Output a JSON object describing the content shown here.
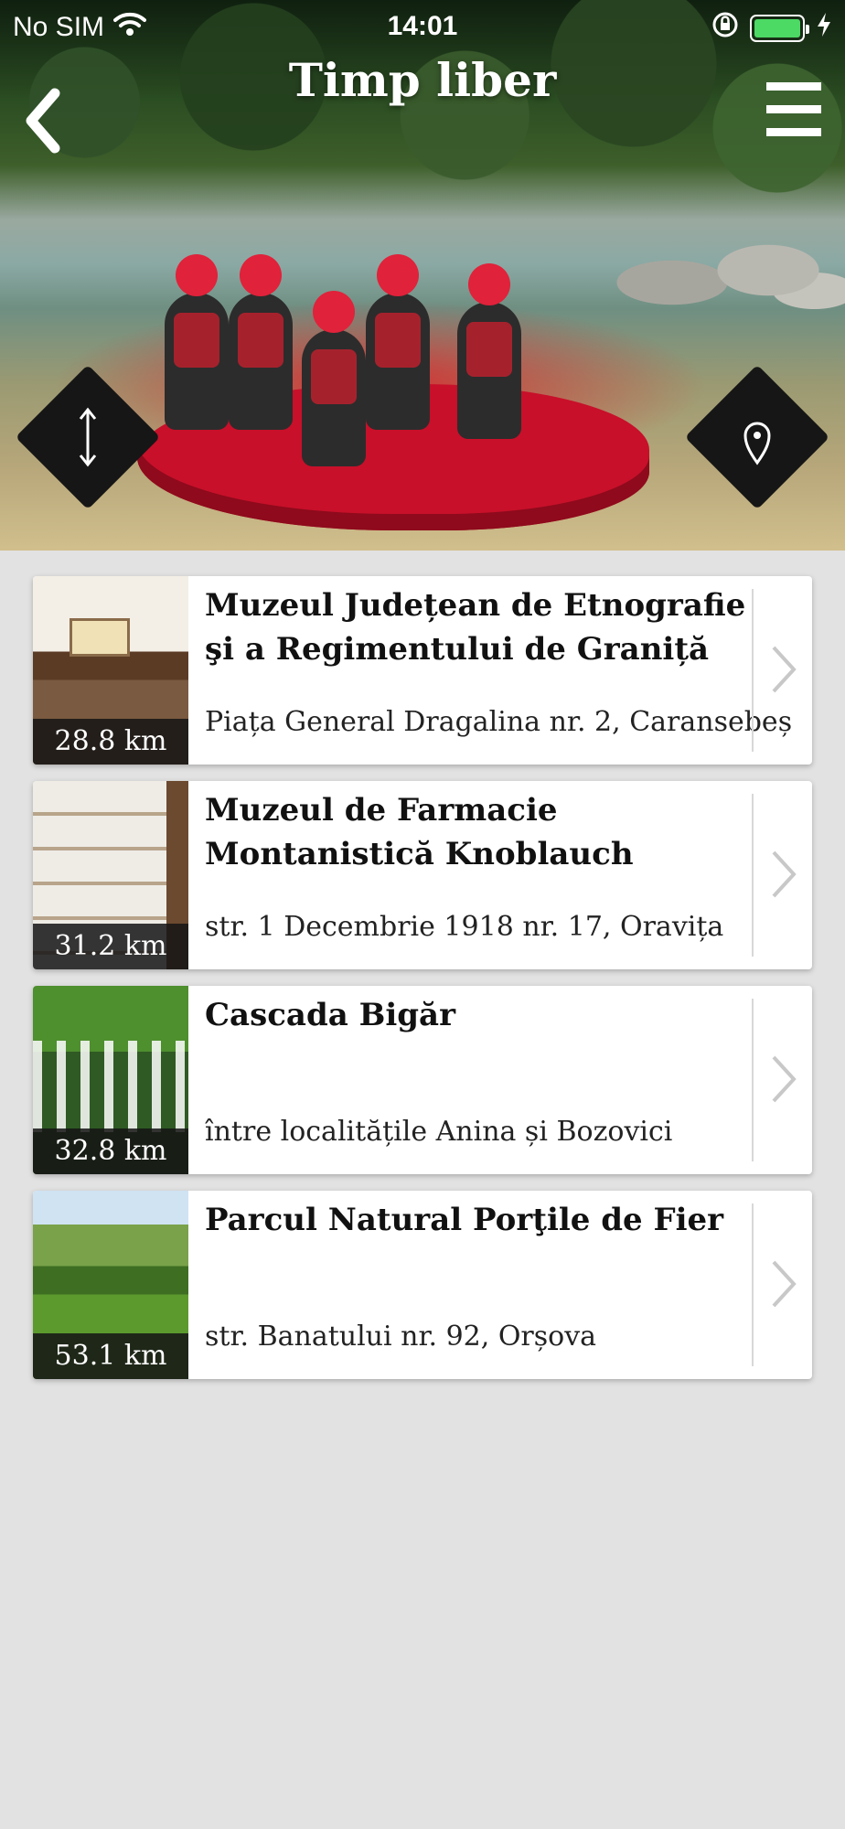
{
  "status_bar": {
    "carrier": "No SIM",
    "time": "14:01"
  },
  "header": {
    "title": "Timp liber"
  },
  "colors": {
    "background": "#e2e2e2",
    "button_dark": "#161616",
    "battery": "#4cd964"
  },
  "items": [
    {
      "title": "Muzeul Județean de Etnografie şi a Regimentului de Graniță",
      "address": "Piața General Dragalina nr. 2, Caransebeș",
      "distance": "28.8 km"
    },
    {
      "title": "Muzeul de Farmacie Montanistică Knoblauch",
      "address": "str. 1 Decembrie 1918 nr. 17, Oravița",
      "distance": "31.2 km"
    },
    {
      "title": "Cascada Bigăr",
      "address": "între localitățile Anina și Bozovici",
      "distance": "32.8 km"
    },
    {
      "title": "Parcul Natural Porţile de Fier",
      "address": "str. Banatului nr. 92, Orșova",
      "distance": "53.1 km"
    }
  ]
}
